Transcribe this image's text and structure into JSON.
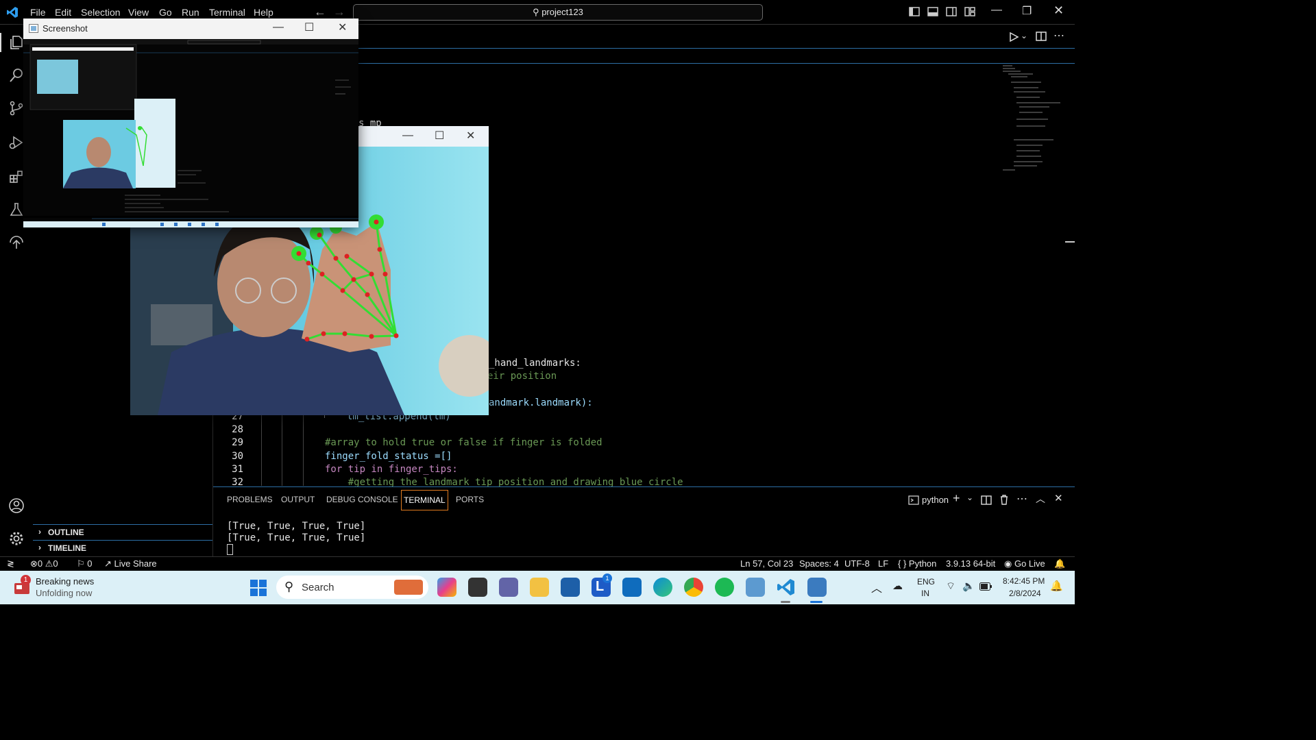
{
  "menu": [
    "File",
    "Edit",
    "Selection",
    "View",
    "Go",
    "Run",
    "Terminal",
    "Help"
  ],
  "search": {
    "text": "project123"
  },
  "sidebar": {
    "outline": "OUTLINE",
    "timeline": "TIMELINE"
  },
  "editor": {
    "partial": {
      "mp": "s mp",
      "hand_landmarks": "_hand_landmarks:",
      "position": "eir position",
      "landmark": "andmark.landmark):",
      "append": "lm_list.append(lm)"
    },
    "lines": [
      {
        "num": "28",
        "code": ""
      },
      {
        "num": "29",
        "code": "#array to hold true or false if finger is folded"
      },
      {
        "num": "30",
        "code": "finger_fold_status =[]"
      },
      {
        "num": "31",
        "code": "for tip in finger_tips:"
      },
      {
        "num": "32",
        "code": "    #getting the landmark tip position and drawing blue circle"
      }
    ],
    "line27": "27"
  },
  "panel": {
    "tabs": [
      "PROBLEMS",
      "OUTPUT",
      "DEBUG CONSOLE",
      "TERMINAL",
      "PORTS"
    ],
    "active_tab": "TERMINAL",
    "terminal_name": "python",
    "output": [
      "[True, True, True, True]",
      "[True, True, True, True]"
    ]
  },
  "status": {
    "errors": "0",
    "warnings": "0",
    "ports": "0",
    "live_share": "Live Share",
    "position": "Ln 57, Col 23",
    "spaces": "Spaces: 4",
    "encoding": "UTF-8",
    "eol": "LF",
    "language": "Python",
    "interpreter": "3.9.13 64-bit",
    "go_live": "Go Live"
  },
  "screenshot_window": {
    "title": "Screenshot"
  },
  "taskbar": {
    "news_title": "Breaking news",
    "news_sub": "Unfolding now",
    "news_badge": "1",
    "search_placeholder": "Search",
    "l_badge": "1",
    "lang": "ENG",
    "region": "IN",
    "time": "8:42:45 PM",
    "date": "2/8/2024"
  },
  "colors": {
    "accent": "#2d6fa6",
    "comment": "#6a9955",
    "keyword": "#c586c0",
    "variable": "#9cdcfe",
    "landmark": "#33dd33",
    "joint": "#dd2222"
  }
}
